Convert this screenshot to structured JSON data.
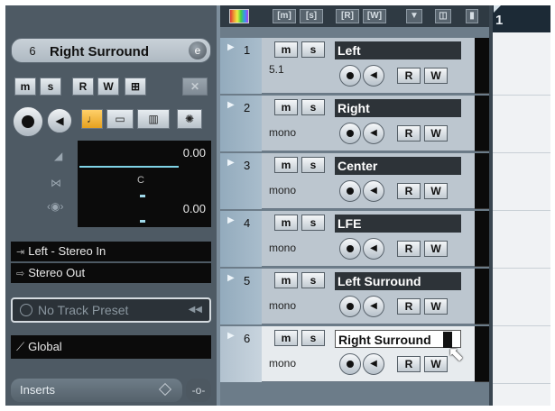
{
  "inspector": {
    "track_number": "6",
    "track_name": "Right Surround",
    "edit_button": "e",
    "buttons": {
      "mute": "m",
      "solo": "s",
      "read": "R",
      "write": "W"
    },
    "volume_value": "0.00",
    "pan_label": "C",
    "delay_value": "0.00",
    "input_routing": "Left - Stereo In",
    "output_routing": "Stereo Out",
    "track_preset": "No Track Preset",
    "automation_mode": "Global",
    "inserts_label": "Inserts"
  },
  "toolbar": {
    "m_label": "m",
    "s_label": "s",
    "r_label": "R",
    "w_label": "W"
  },
  "tracks": [
    {
      "number": "1",
      "name": "Left",
      "format": "5.1",
      "mute": "m",
      "solo": "s",
      "read": "R",
      "write": "W"
    },
    {
      "number": "2",
      "name": "Right",
      "format": "mono",
      "mute": "m",
      "solo": "s",
      "read": "R",
      "write": "W"
    },
    {
      "number": "3",
      "name": "Center",
      "format": "mono",
      "mute": "m",
      "solo": "s",
      "read": "R",
      "write": "W"
    },
    {
      "number": "4",
      "name": "LFE",
      "format": "mono",
      "mute": "m",
      "solo": "s",
      "read": "R",
      "write": "W"
    },
    {
      "number": "5",
      "name": "Left Surround",
      "format": "mono",
      "mute": "m",
      "solo": "s",
      "read": "R",
      "write": "W"
    },
    {
      "number": "6",
      "name": "Right Surround",
      "format": "mono",
      "mute": "m",
      "solo": "s",
      "read": "R",
      "write": "W"
    }
  ],
  "ruler": {
    "bar_marker": "1"
  },
  "colors": {
    "selected_track": "#e7ebee",
    "track_body": "#bcc6cf",
    "meter_line": "#7fd3e6"
  }
}
